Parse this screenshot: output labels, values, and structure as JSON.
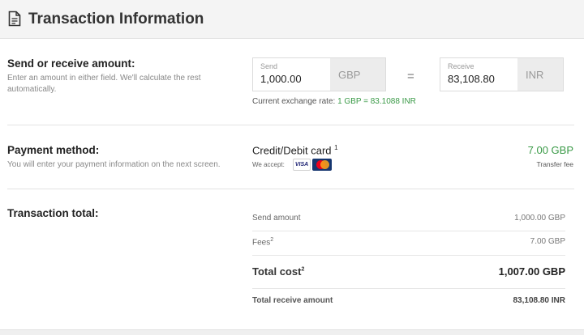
{
  "header": {
    "title": "Transaction Information",
    "icon": "document-icon"
  },
  "amount_section": {
    "label": "Send or receive amount:",
    "help": "Enter an amount in either field. We'll calculate the rest automatically.",
    "send": {
      "label": "Send",
      "value": "1,000.00",
      "currency": "GBP"
    },
    "equals": "=",
    "receive": {
      "label": "Receive",
      "value": "83,108.80",
      "currency": "INR"
    },
    "rate_prefix": "Current exchange rate:",
    "rate_value": "1 GBP = 83.1088 INR"
  },
  "payment_section": {
    "label": "Payment method:",
    "help": "You will enter your payment information on the next screen.",
    "method": "Credit/Debit card",
    "method_note": "1",
    "we_accept": "We accept:",
    "cards": [
      "VISA",
      "MasterCard"
    ],
    "fee_amount": "7.00 GBP",
    "fee_label": "Transfer fee"
  },
  "total_section": {
    "label": "Transaction total:",
    "rows": [
      {
        "label": "Send amount",
        "note": "",
        "value": "1,000.00 GBP"
      },
      {
        "label": "Fees",
        "note": "2",
        "value": "7.00 GBP"
      },
      {
        "label": "Total cost",
        "note": "2",
        "value": "1,007.00 GBP"
      },
      {
        "label": "Total receive amount",
        "note": "",
        "value": "83,108.80 INR"
      }
    ]
  },
  "colors": {
    "accent_green": "#3a9a47",
    "header_bg": "#f4f4f4",
    "currency_bg": "#ececec"
  }
}
